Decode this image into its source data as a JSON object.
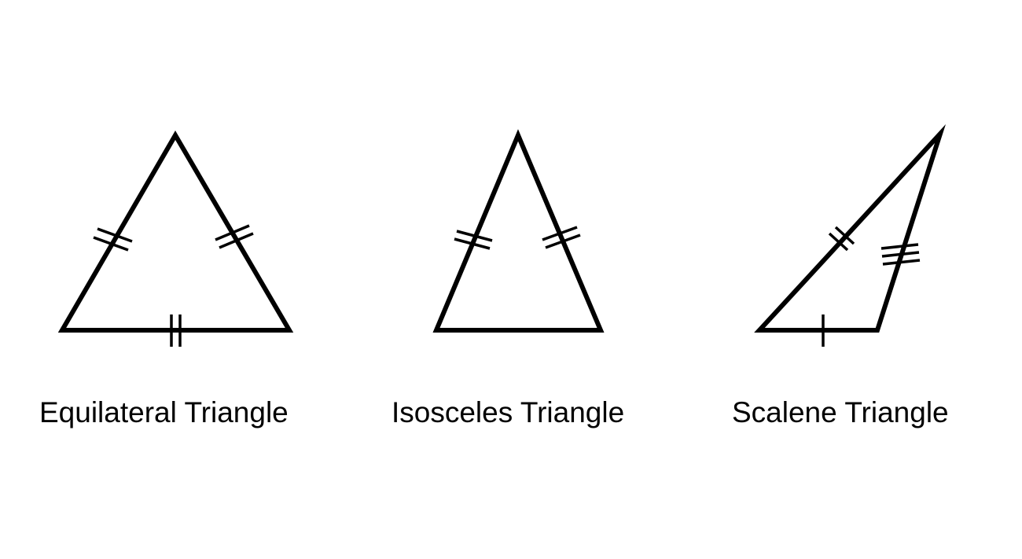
{
  "colors": {
    "background": "#ffffff",
    "stroke": "#000000"
  },
  "triangles": [
    {
      "type": "equilateral",
      "label": "Equilateral Triangle",
      "equal_side_ticks": [
        2,
        2,
        2
      ]
    },
    {
      "type": "isosceles",
      "label": "Isosceles Triangle",
      "equal_side_ticks": [
        2,
        2,
        0
      ]
    },
    {
      "type": "scalene",
      "label": "Scalene Triangle",
      "equal_side_ticks": [
        1,
        2,
        3
      ]
    }
  ]
}
